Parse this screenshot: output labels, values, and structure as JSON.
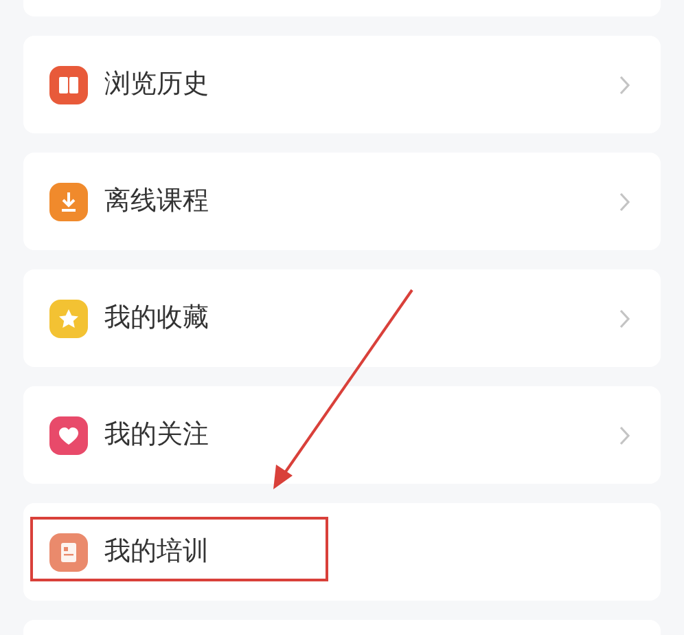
{
  "menu_items": [
    {
      "label": "浏览历史",
      "color": "#e85a3a",
      "chevron": true,
      "highlighted": false
    },
    {
      "label": "离线课程",
      "color": "#f08a2c",
      "chevron": true,
      "highlighted": false
    },
    {
      "label": "我的收藏",
      "color": "#f3c233",
      "chevron": true,
      "highlighted": false
    },
    {
      "label": "我的关注",
      "color": "#e84a6a",
      "chevron": true,
      "highlighted": false
    },
    {
      "label": "我的培训",
      "color": "#ea8a6c",
      "chevron": false,
      "highlighted": true
    }
  ]
}
